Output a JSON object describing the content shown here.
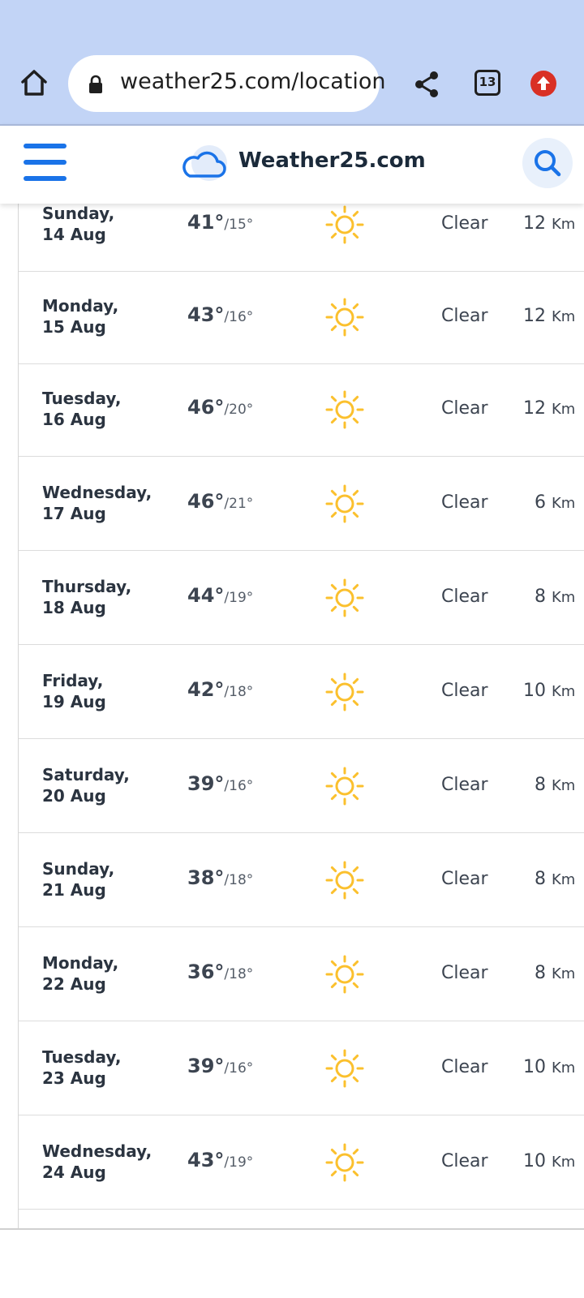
{
  "browser": {
    "url": "weather25.com/location",
    "tab_count": "13"
  },
  "site": {
    "name": "Weather25.com"
  },
  "forecast": [
    {
      "day": "Sunday,",
      "date": "14 Aug",
      "high": "41",
      "low": "/15°",
      "condition": "Clear",
      "wind": "12",
      "wind_unit": "Km"
    },
    {
      "day": "Monday,",
      "date": "15 Aug",
      "high": "43",
      "low": "/16°",
      "condition": "Clear",
      "wind": "12",
      "wind_unit": "Km"
    },
    {
      "day": "Tuesday,",
      "date": "16 Aug",
      "high": "46",
      "low": "/20°",
      "condition": "Clear",
      "wind": "12",
      "wind_unit": "Km"
    },
    {
      "day": "Wednesday,",
      "date": "17 Aug",
      "high": "46",
      "low": "/21°",
      "condition": "Clear",
      "wind": "6",
      "wind_unit": "Km"
    },
    {
      "day": "Thursday,",
      "date": "18 Aug",
      "high": "44",
      "low": "/19°",
      "condition": "Clear",
      "wind": "8",
      "wind_unit": "Km"
    },
    {
      "day": "Friday,",
      "date": "19 Aug",
      "high": "42",
      "low": "/18°",
      "condition": "Clear",
      "wind": "10",
      "wind_unit": "Km"
    },
    {
      "day": "Saturday,",
      "date": "20 Aug",
      "high": "39",
      "low": "/16°",
      "condition": "Clear",
      "wind": "8",
      "wind_unit": "Km"
    },
    {
      "day": "Sunday,",
      "date": "21 Aug",
      "high": "38",
      "low": "/18°",
      "condition": "Clear",
      "wind": "8",
      "wind_unit": "Km"
    },
    {
      "day": "Monday,",
      "date": "22 Aug",
      "high": "36",
      "low": "/18°",
      "condition": "Clear",
      "wind": "8",
      "wind_unit": "Km"
    },
    {
      "day": "Tuesday,",
      "date": "23 Aug",
      "high": "39",
      "low": "/16°",
      "condition": "Clear",
      "wind": "10",
      "wind_unit": "Km"
    },
    {
      "day": "Wednesday,",
      "date": "24 Aug",
      "high": "43",
      "low": "/19°",
      "condition": "Clear",
      "wind": "10",
      "wind_unit": "Km"
    }
  ],
  "icons": {
    "home": "home-icon",
    "lock": "lock-icon",
    "share": "share-icon",
    "update": "update-arrow-icon",
    "menu": "hamburger-menu-icon",
    "logo": "cloud-logo-icon",
    "search": "search-icon",
    "weather": "sun-icon"
  },
  "colors": {
    "browser_bar": "#c2d4f6",
    "accent_blue": "#1a73e8",
    "sun_yellow": "#fbc02d",
    "update_red": "#d93025"
  }
}
